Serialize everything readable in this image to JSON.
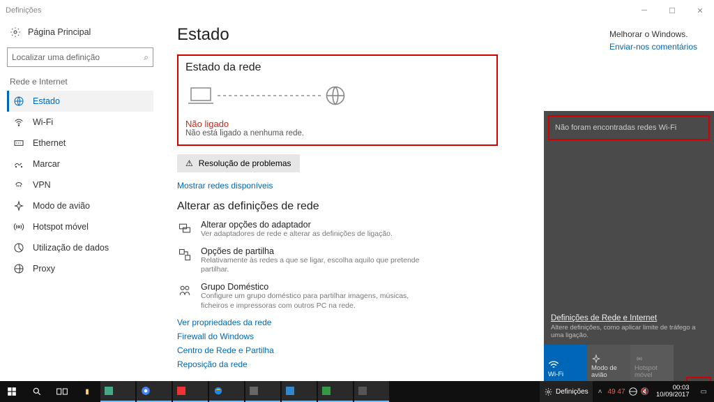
{
  "titlebar": {
    "title": "Definições"
  },
  "left": {
    "home": "Página Principal",
    "search_placeholder": "Localizar uma definição",
    "category": "Rede e Internet",
    "items": [
      {
        "label": "Estado",
        "active": true
      },
      {
        "label": "Wi-Fi"
      },
      {
        "label": "Ethernet"
      },
      {
        "label": "Marcar"
      },
      {
        "label": "VPN"
      },
      {
        "label": "Modo de avião"
      },
      {
        "label": "Hotspot móvel"
      },
      {
        "label": "Utilização de dados"
      },
      {
        "label": "Proxy"
      }
    ]
  },
  "main": {
    "title": "Estado",
    "net_status_heading": "Estado da rede",
    "not_connected": "Não ligado",
    "not_connected_sub": "Não está ligado a nenhuma rede.",
    "troubleshoot": "Resolução de problemas",
    "show_networks": "Mostrar redes disponíveis",
    "change_heading": "Alterar as definições de rede",
    "opts": [
      {
        "title": "Alterar opções do adaptador",
        "desc": "Ver adaptadores de rede e alterar as definições de ligação."
      },
      {
        "title": "Opções de partilha",
        "desc": "Relativamente às redes a que se ligar, escolha aquilo que pretende partilhar."
      },
      {
        "title": "Grupo Doméstico",
        "desc": "Configure um grupo doméstico para partilhar imagens, músicas, ficheiros e impressoras com outros PC na rede."
      }
    ],
    "links": [
      "Ver propriedades da rede",
      "Firewall do Windows",
      "Centro de Rede e Partilha",
      "Reposição da rede"
    ]
  },
  "right": {
    "improve": "Melhorar o Windows.",
    "feedback": "Enviar-nos comentários"
  },
  "flyout": {
    "no_wifi": "Não foram encontradas redes Wi-Fi",
    "settings_link": "Definições de Rede e Internet",
    "settings_sub": "Altere definições, como aplicar limite de tráfego a uma ligação.",
    "tiles": [
      {
        "label": "Wi-Fi"
      },
      {
        "label": "Modo de avião"
      },
      {
        "label": "Hotspot móvel"
      }
    ]
  },
  "taskbar": {
    "defs": "Definições",
    "temps": "49  47",
    "time": "00:03",
    "date": "10/09/2017"
  }
}
